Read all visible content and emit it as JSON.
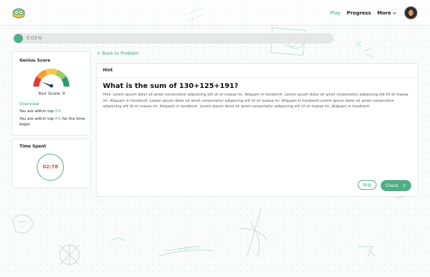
{
  "header": {
    "nav": [
      {
        "label": "Play",
        "active": true
      },
      {
        "label": "Progress",
        "active": false
      }
    ],
    "more_label": "More",
    "icons": {
      "logo": "owl-logo-icon",
      "avatar": "user-avatar",
      "more": "chevron-down-icon"
    }
  },
  "progress": {
    "label": "0.01%",
    "value_percent": 0.01
  },
  "genius_score": {
    "title": "Genius Score",
    "score_label": "Your Score: 0",
    "overview_label": "Overview",
    "within_top_1": {
      "prefix": "You are within top ",
      "pct": "0%"
    },
    "within_top_2": {
      "prefix": "You are within top ",
      "pct": "0%",
      "suffix": " for the time begin"
    },
    "gauge_colors": [
      "#e53935",
      "#f39c36",
      "#f2c94c",
      "#9ccc65",
      "#2e9e6b"
    ]
  },
  "time_spent": {
    "title": "Time Spent",
    "value": "02:78"
  },
  "back_link": "Back to Problem",
  "hint_card": {
    "header": "Hint",
    "question": "What is the sum of 130+125+191?",
    "body": "Hint: Lorem ipsum dolor sit amet consectetur adipiscing elit Ut et massa mi. Aliquam in hendrerit. Lorem ipsum dolor sit amet consectetur adipiscing elit Ut et massa mi. Aliquam in hendrerit. Lorem ipsum dolor sit amet consectetur adipiscing elit Ut et massa mi. Aliquam in hendrerit.Lorem ipsum dolor sit amet consectetur adipiscing elit Ut et massa mi. Aliquam in hendrerit. Lorem ipsum dolor sit amet consectetur adipiscing elit Ut et massa mi. Aliquam in hendrerit."
  },
  "buttons": {
    "skip": "Skip",
    "check": "Check"
  },
  "colors": {
    "accent": "#4fae86",
    "timer": "#d9502e"
  }
}
